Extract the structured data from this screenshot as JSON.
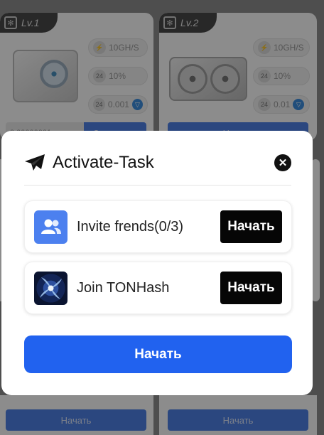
{
  "background": {
    "cards": [
      {
        "level": "Lv.1",
        "stats": {
          "hashrate": "10GH/S",
          "percent": "10%",
          "reward": "0.001"
        },
        "amount": "0.00000001",
        "action_label": "Запустить"
      },
      {
        "level": "Lv.2",
        "stats": {
          "hashrate": "10GH/S",
          "percent": "10%",
          "reward": "0.01"
        },
        "action_label": "Начать"
      }
    ],
    "bottom_buttons": [
      "Начать",
      "Начать"
    ]
  },
  "modal": {
    "title": "Activate-Task",
    "tasks": [
      {
        "label": "Invite frends(0/3)",
        "button": "Начать",
        "icon": "users-icon"
      },
      {
        "label": "Join TONHash",
        "button": "Начать",
        "icon": "tonhash-logo-icon"
      }
    ],
    "main_button": "Начать"
  },
  "colors": {
    "primary_blue": "#2162ef",
    "task_button": "#060606",
    "icon_blue": "#4c80ef"
  }
}
